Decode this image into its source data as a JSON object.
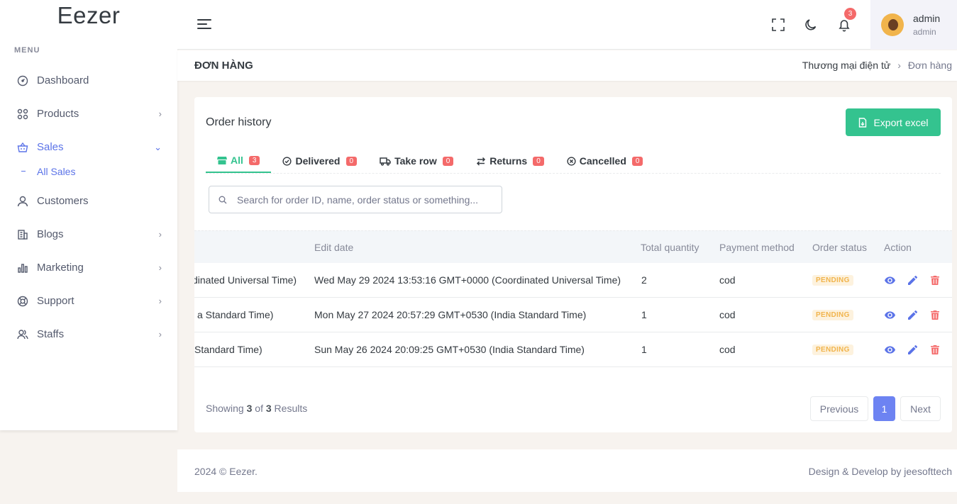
{
  "brand": "Eezer",
  "sidebar": {
    "menu_title": "MENU",
    "items": [
      {
        "label": "Dashboard"
      },
      {
        "label": "Products"
      },
      {
        "label": "Sales"
      },
      {
        "label": "All Sales"
      },
      {
        "label": "Customers"
      },
      {
        "label": "Blogs"
      },
      {
        "label": "Marketing"
      },
      {
        "label": "Support"
      },
      {
        "label": "Staffs"
      }
    ]
  },
  "topbar": {
    "notification_count": "3",
    "user_name": "admin",
    "user_role": "admin"
  },
  "page": {
    "title": "ĐƠN HÀNG",
    "breadcrumb": [
      "Thương mại điện tử",
      "Đơn hàng"
    ]
  },
  "card": {
    "title": "Order history",
    "export_label": "Export excel",
    "tabs": [
      {
        "label": "All",
        "count": "3"
      },
      {
        "label": "Delivered",
        "count": "0"
      },
      {
        "label": "Take row",
        "count": "0"
      },
      {
        "label": "Returns",
        "count": "0"
      },
      {
        "label": "Cancelled",
        "count": "0"
      }
    ],
    "search_placeholder": "Search for order ID, name, order status or something..."
  },
  "table": {
    "headers": [
      "Edit date",
      "Total quantity",
      "Payment method",
      "Order status",
      "Action"
    ],
    "rows": [
      {
        "created": "dinated Universal Time)",
        "edit_date": "Wed May 29 2024 13:53:16 GMT+0000 (Coordinated Universal Time)",
        "qty": "2",
        "payment": "cod",
        "status": "PENDING"
      },
      {
        "created": "a Standard Time)",
        "edit_date": "Mon May 27 2024 20:57:29 GMT+0530 (India Standard Time)",
        "qty": "1",
        "payment": "cod",
        "status": "PENDING"
      },
      {
        "created": " Standard Time)",
        "edit_date": "Sun May 26 2024 20:09:25 GMT+0530 (India Standard Time)",
        "qty": "1",
        "payment": "cod",
        "status": "PENDING"
      }
    ]
  },
  "pagination": {
    "showing_prefix": "Showing",
    "shown": "3",
    "of": "of",
    "total": "3",
    "results": "Results",
    "previous": "Previous",
    "page": "1",
    "next": "Next"
  },
  "footer": {
    "left": "2024 © Eezer.",
    "right": "Design & Develop by jeesofttech"
  },
  "colors": {
    "primary": "#5b73e8",
    "success": "#34c38f",
    "danger": "#f46a6a",
    "warning": "#f1b44c"
  }
}
